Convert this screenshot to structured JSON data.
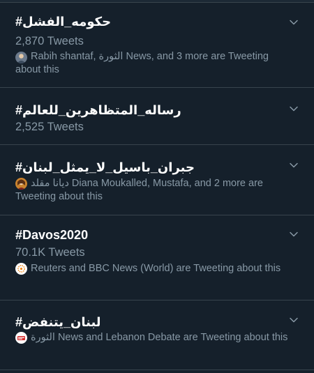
{
  "colors": {
    "background": "#15202b",
    "divider": "#38444d",
    "primary_text": "#ffffff",
    "secondary_text": "#8899a6"
  },
  "trends": [
    {
      "title": "#حكومه_الفشل",
      "count": "2,870 Tweets",
      "context": "Rabih shantaf, الثورة News, and 3 more are Tweeting about this",
      "avatar_icon": "rabih-avatar-icon",
      "menu_icon": "chevron-down-icon"
    },
    {
      "title": "#رساله_المتظاهرين_للعالم",
      "count": "2,525 Tweets",
      "menu_icon": "chevron-down-icon"
    },
    {
      "title": "#جبران_باسيل_لا_يمثل_لبنان",
      "context": "ديانا مقلد Diana Moukalled, Mustafa, and 2 more are Tweeting about this",
      "avatar_icon": "diana-avatar-icon",
      "menu_icon": "chevron-down-icon"
    },
    {
      "title": "#Davos2020",
      "count": "70.1K Tweets",
      "context": "Reuters and BBC News (World) are Tweeting about this",
      "avatar_icon": "reuters-avatar-icon",
      "menu_icon": "chevron-down-icon"
    },
    {
      "title": "#لبنان_يتنفض",
      "context": "الثورة News and Lebanon Debate are Tweeting about this",
      "avatar_icon": "thawra-news-avatar-icon",
      "menu_icon": "chevron-down-icon"
    }
  ]
}
